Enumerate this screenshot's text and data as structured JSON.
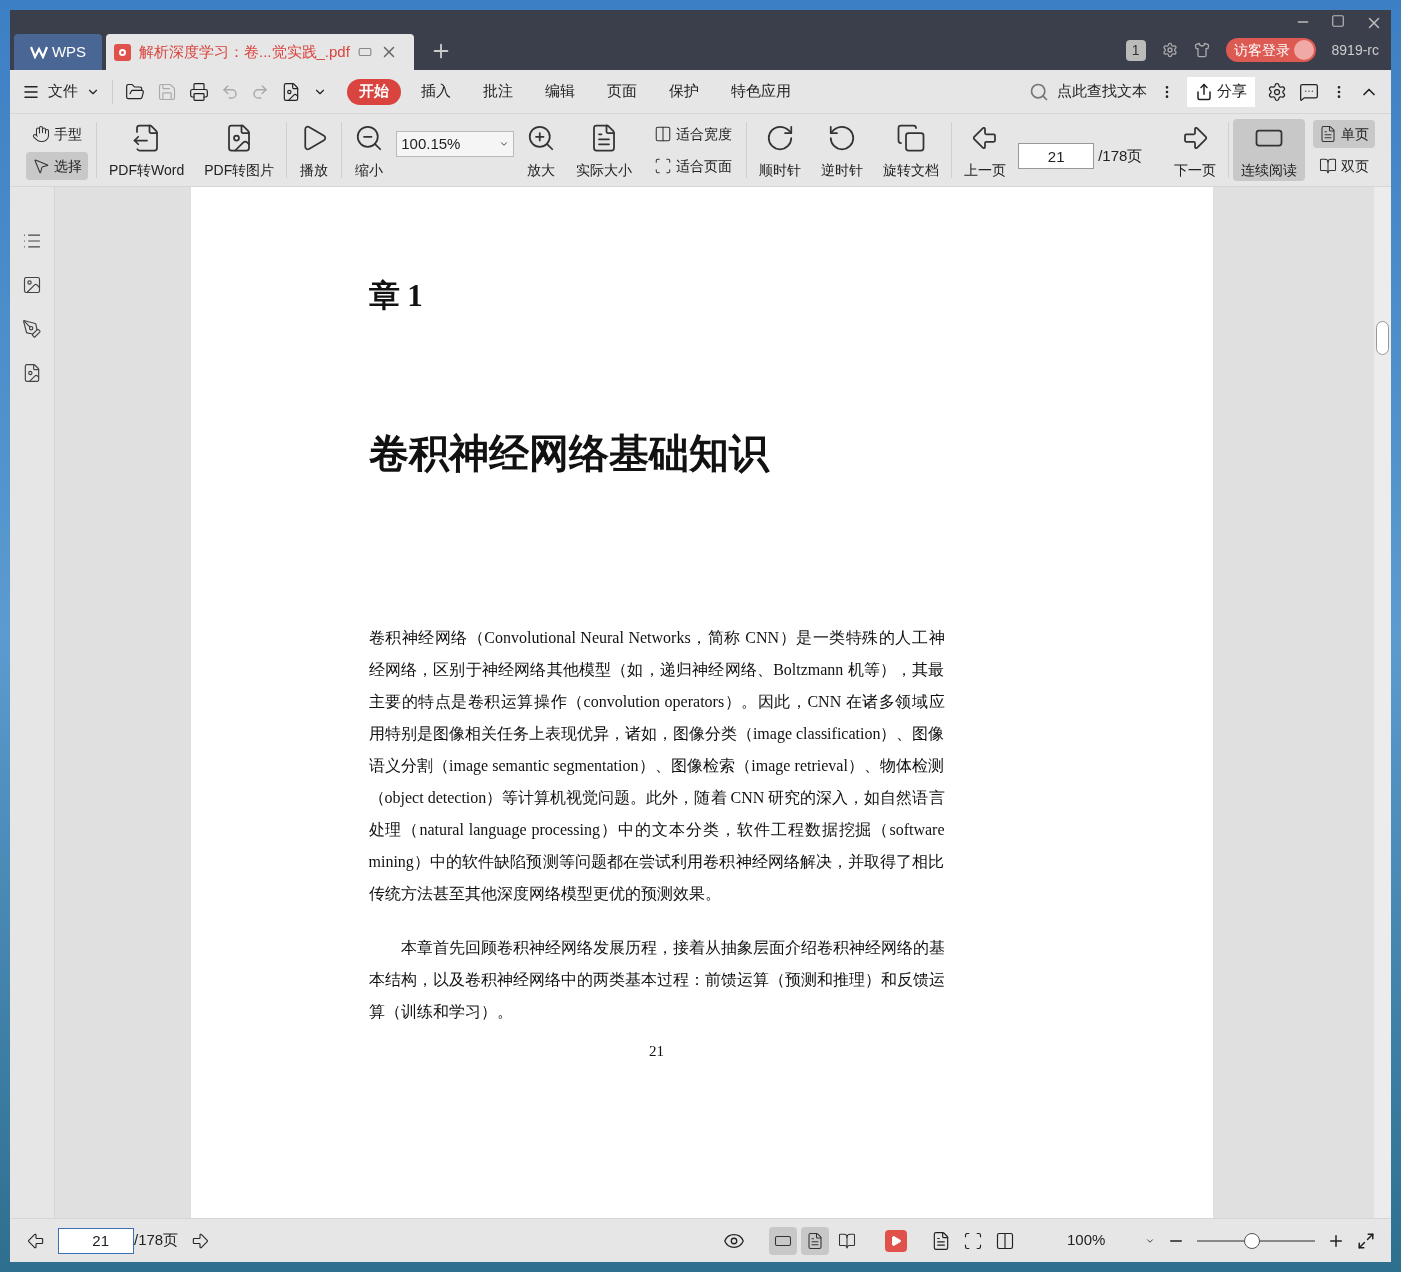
{
  "tabs": [
    {
      "kind": "home",
      "label": "WPS",
      "selected": false
    },
    {
      "kind": "doc",
      "label": "解析深度学习：卷...觉实践_.pdf",
      "selected": true
    }
  ],
  "title_bar": {
    "badge": "1",
    "login": "访客登录",
    "user": "8919-rc"
  },
  "menu": {
    "file": "文件",
    "tabs": [
      {
        "label": "开始",
        "selected": true
      },
      {
        "label": "插入",
        "selected": false
      },
      {
        "label": "批注",
        "selected": false
      },
      {
        "label": "编辑",
        "selected": false
      },
      {
        "label": "页面",
        "selected": false
      },
      {
        "label": "保护",
        "selected": false
      },
      {
        "label": "特色应用",
        "selected": false
      }
    ],
    "search": "点此查找文本",
    "share": "分享"
  },
  "ribbon": [
    {
      "kind": "pair",
      "items": [
        {
          "label": "手型",
          "selected": false
        },
        {
          "label": "选择",
          "selected": true
        }
      ]
    },
    {
      "kind": "big",
      "label": "PDF转Word",
      "selected": false
    },
    {
      "kind": "big",
      "label": "PDF转图片",
      "selected": false
    },
    {
      "kind": "big",
      "label": "播放",
      "selected": false
    },
    {
      "kind": "zoom",
      "label": "缩小",
      "value": "100.15%"
    },
    {
      "kind": "big",
      "label": "放大",
      "selected": false
    },
    {
      "kind": "big",
      "label": "实际大小",
      "selected": false
    },
    {
      "kind": "pair",
      "items": [
        {
          "label": "适合宽度",
          "selected": false
        },
        {
          "label": "适合页面",
          "selected": false
        }
      ]
    },
    {
      "kind": "big",
      "label": "顺时针",
      "selected": false
    },
    {
      "kind": "big",
      "label": "逆时针",
      "selected": false
    },
    {
      "kind": "big",
      "label": "旋转文档",
      "selected": false
    },
    {
      "kind": "big",
      "label": "上一页",
      "selected": false
    },
    {
      "kind": "page",
      "value": "21",
      "total": "/178页"
    },
    {
      "kind": "big",
      "label": "下一页",
      "selected": false
    },
    {
      "kind": "big",
      "label": "连续阅读",
      "selected": true
    },
    {
      "kind": "pair",
      "items": [
        {
          "label": "单页",
          "selected": true
        },
        {
          "label": "双页",
          "selected": false
        }
      ]
    }
  ],
  "page": {
    "chapter": "章 1",
    "title": "卷积神经网络基础知识",
    "paragraphs": [
      {
        "indent": false,
        "text": "卷积神经网络（Convolutional Neural Networks，简称 CNN）是一类特殊的人工神经网络，区别于神经网络其他模型（如，递归神经网络、Boltzmann 机等），其最主要的特点是卷积运算操作（convolution operators）。因此，CNN 在诸多领域应用特别是图像相关任务上表现优异，诸如，图像分类（image classification）、图像语义分割（image semantic segmentation）、图像检索（image retrieval）、物体检测（object detection）等计算机视觉问题。此外，随着 CNN 研究的深入，如自然语言处理（natural language processing）中的文本分类，软件工程数据挖掘（software mining）中的软件缺陷预测等问题都在尝试利用卷积神经网络解决，并取得了相比传统方法甚至其他深度网络模型更优的预测效果。"
      },
      {
        "indent": true,
        "text": "本章首先回顾卷积神经网络发展历程，接着从抽象层面介绍卷积神经网络的基本结构，以及卷积神经网络中的两类基本过程：前馈运算（预测和推理）和反馈运算（训练和学习）。"
      }
    ],
    "page_number": "21"
  },
  "status_bar": {
    "page": "21",
    "total": "/178页",
    "views": [
      {
        "selected": true
      },
      {
        "selected": true
      },
      {
        "selected": false
      }
    ],
    "zoom": "100%",
    "zoom_slider": {
      "level": 0.47
    }
  }
}
